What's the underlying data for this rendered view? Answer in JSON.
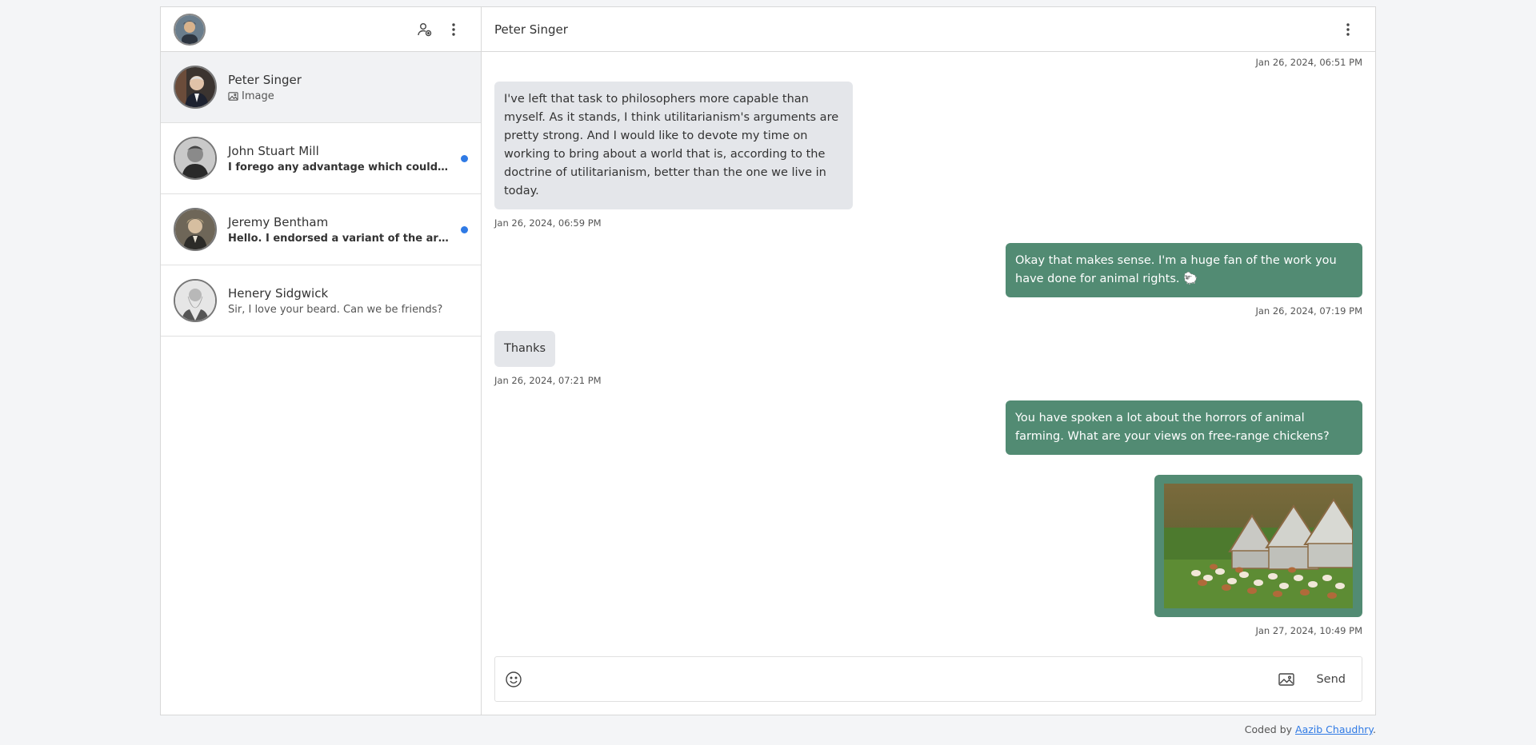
{
  "sidebar": {
    "chats": [
      {
        "name": "Peter Singer",
        "preview": "Image",
        "unread": false
      },
      {
        "name": "John Stuart Mill",
        "preview": "I forego any advantage which could be derived to my argument from the idea of abstract right",
        "unread": true
      },
      {
        "name": "Jeremy Bentham",
        "preview": "Hello. I endorsed a variant of the argument from marginal cases",
        "unread": true
      },
      {
        "name": "Henery Sidgwick",
        "preview": "Sir, I love your beard. Can we be friends?",
        "unread": false
      }
    ]
  },
  "main": {
    "title": "Peter Singer",
    "top_timestamp": "Jan 26, 2024, 06:51 PM",
    "messages": [
      {
        "direction": "in",
        "text": "I've left that task to philosophers more capable than myself. As it stands, I think utilitarianism's arguments are pretty strong. And I would like to devote my time on working to bring about a world that is, according to the doctrine of utilitarianism, better than the one we live in today.",
        "time": "Jan 26, 2024, 06:59 PM"
      },
      {
        "direction": "out",
        "text": "Okay that makes sense. I'm a huge fan of the work you have done for animal rights. 🐑",
        "time": "Jan 26, 2024, 07:19 PM"
      },
      {
        "direction": "in",
        "text": "Thanks",
        "time": "Jan 26, 2024, 07:21 PM"
      },
      {
        "direction": "out",
        "text": "You have spoken a lot about the horrors of animal farming. What are your views on free-range chickens?",
        "time": ""
      },
      {
        "direction": "out",
        "image": "free-range-chickens-photo",
        "time": "Jan 27, 2024, 10:49 PM"
      }
    ]
  },
  "composer": {
    "placeholder": "",
    "send_label": "Send"
  },
  "footer": {
    "prefix": "Coded by ",
    "link_text": "Aazib Chaudhry",
    "suffix": "."
  },
  "colors": {
    "outgoing_bubble": "#528b73",
    "incoming_bubble": "#e4e6ea",
    "unread_dot": "#2f7ae5"
  }
}
